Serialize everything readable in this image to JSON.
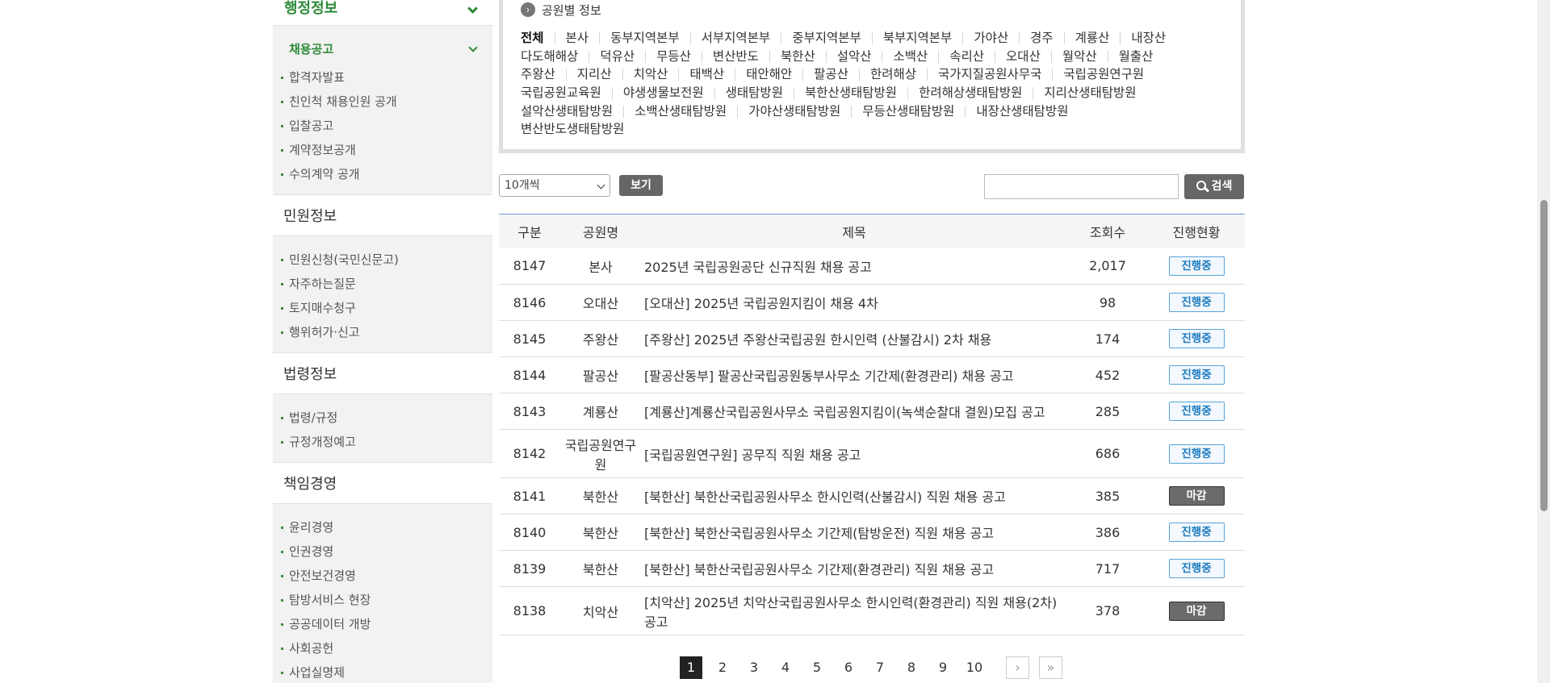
{
  "sidebar": {
    "top_header": "행정정보",
    "sub_header": "채용공고",
    "sub_items": [
      "합격자발표",
      "친인척 채용인원 공개",
      "입찰공고",
      "계약정보공개",
      "수의계약 공개"
    ],
    "sections": [
      {
        "title": "민원정보",
        "items": [
          "민원신청(국민신문고)",
          "자주하는질문",
          "토지매수청구",
          "행위허가·신고"
        ]
      },
      {
        "title": "법령정보",
        "items": [
          "법령/규정",
          "규정개정예고"
        ]
      },
      {
        "title": "책임경영",
        "items": [
          "윤리경영",
          "인권경영",
          "안전보건경영",
          "탐방서비스 현장",
          "공공데이터 개방",
          "사회공헌",
          "사업실명제"
        ]
      }
    ]
  },
  "filter": {
    "title": "공원별 정보",
    "parks": [
      "전체",
      "본사",
      "동부지역본부",
      "서부지역본부",
      "중부지역본부",
      "북부지역본부",
      "가야산",
      "경주",
      "계룡산",
      "내장산",
      "다도해해상",
      "덕유산",
      "무등산",
      "변산반도",
      "북한산",
      "설악산",
      "소백산",
      "속리산",
      "오대산",
      "월악산",
      "월출산",
      "주왕산",
      "지리산",
      "치악산",
      "태백산",
      "태안해안",
      "팔공산",
      "한려해상",
      "국가지질공원사무국",
      "국립공원연구원",
      "국립공원교육원",
      "야생생물보전원",
      "생태탐방원",
      "북한산생태탐방원",
      "한려해상생태탐방원",
      "지리산생태탐방원",
      "설악산생태탐방원",
      "소백산생태탐방원",
      "가야산생태탐방원",
      "무등산생태탐방원",
      "내장산생태탐방원",
      "변산반도생태탐방원"
    ],
    "line_breaks_before": [
      10,
      21,
      30,
      36,
      41
    ]
  },
  "toolbar": {
    "page_size": "10개씩",
    "view_label": "보기",
    "search_value": "",
    "search_label": "검색"
  },
  "table": {
    "headers": [
      "구분",
      "공원명",
      "제목",
      "조회수",
      "진행현황"
    ],
    "rows": [
      {
        "no": "8147",
        "park": "본사",
        "title": "2025년 국립공원공단 신규직원 채용 공고",
        "views": "2,017",
        "status": "진행중",
        "closed": false
      },
      {
        "no": "8146",
        "park": "오대산",
        "title": "[오대산] 2025년 국립공원지킴이 채용 4차",
        "views": "98",
        "status": "진행중",
        "closed": false
      },
      {
        "no": "8145",
        "park": "주왕산",
        "title": "[주왕산] 2025년 주왕산국립공원 한시인력 (산불감시) 2차 채용",
        "views": "174",
        "status": "진행중",
        "closed": false
      },
      {
        "no": "8144",
        "park": "팔공산",
        "title": "[팔공산동부] 팔공산국립공원동부사무소 기간제(환경관리) 채용 공고",
        "views": "452",
        "status": "진행중",
        "closed": false
      },
      {
        "no": "8143",
        "park": "계룡산",
        "title": "[계룡산]계룡산국립공원사무소 국립공원지킴이(녹색순찰대 결원)모집 공고",
        "views": "285",
        "status": "진행중",
        "closed": false
      },
      {
        "no": "8142",
        "park": "국립공원연구원",
        "title": "[국립공원연구원] 공무직 직원 채용 공고",
        "views": "686",
        "status": "진행중",
        "closed": false,
        "tall": true
      },
      {
        "no": "8141",
        "park": "북한산",
        "title": "[북한산] 북한산국립공원사무소 한시인력(산불감시) 직원 채용 공고",
        "views": "385",
        "status": "마감",
        "closed": true
      },
      {
        "no": "8140",
        "park": "북한산",
        "title": "[북한산] 북한산국립공원사무소 기간제(탐방운전) 직원 채용 공고",
        "views": "386",
        "status": "진행중",
        "closed": false
      },
      {
        "no": "8139",
        "park": "북한산",
        "title": "[북한산] 북한산국립공원사무소 기간제(환경관리) 직원 채용 공고",
        "views": "717",
        "status": "진행중",
        "closed": false
      },
      {
        "no": "8138",
        "park": "치악산",
        "title": "[치악산] 2025년 치악산국립공원사무소 한시인력(환경관리) 직원 채용(2차) 공고",
        "views": "378",
        "status": "마감",
        "closed": true,
        "tall": true
      }
    ]
  },
  "pagination": {
    "pages": [
      "1",
      "2",
      "3",
      "4",
      "5",
      "6",
      "7",
      "8",
      "9",
      "10"
    ],
    "current": "1",
    "next": "›",
    "last": "»"
  }
}
